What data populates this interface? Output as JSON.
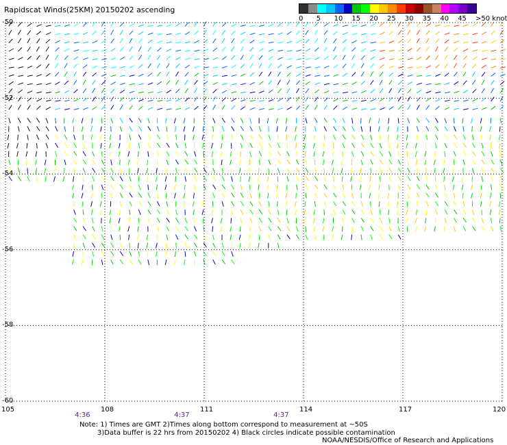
{
  "title": "Rapidscat Winds(25KM) 20150202 ascending",
  "legend": {
    "colors": [
      "#303030",
      "#8a8a8a",
      "#00ffff",
      "#00c8ff",
      "#0064ff",
      "#0000c8",
      "#00c800",
      "#00ff00",
      "#ffff00",
      "#ffc800",
      "#ff8c00",
      "#ff3c00",
      "#c80000",
      "#8c0000",
      "#a05028",
      "#c88264",
      "#ff00ff",
      "#b400ff",
      "#7800c8",
      "#3c0096"
    ],
    "labels": [
      "0",
      "5",
      "10",
      "15",
      "20",
      "25",
      "30",
      "35",
      "40",
      "45",
      ">50 knots"
    ]
  },
  "axes": {
    "lon_labels": [
      "105",
      "108",
      "111",
      "114",
      "117",
      "120"
    ],
    "lat_labels": [
      "-50",
      "-52",
      "-54",
      "-56",
      "-58",
      "-60"
    ],
    "lon_range": [
      105,
      120
    ],
    "lat_range": [
      -60,
      -50
    ],
    "time_labels": [
      {
        "text": "4:36",
        "lon": 107.3
      },
      {
        "text": "4:37",
        "lon": 110.3
      },
      {
        "text": "4:37",
        "lon": 113.3
      }
    ]
  },
  "notes": [
    "Note: 1) Times are GMT 2)Times along bottom correspond to measurement at ~50S",
    "3)Data buffer is 22 hrs from 20150202 4) Black circles indicate possible contamination"
  ],
  "credit": "NOAA/NESDIS/Office of Research and Applications"
}
